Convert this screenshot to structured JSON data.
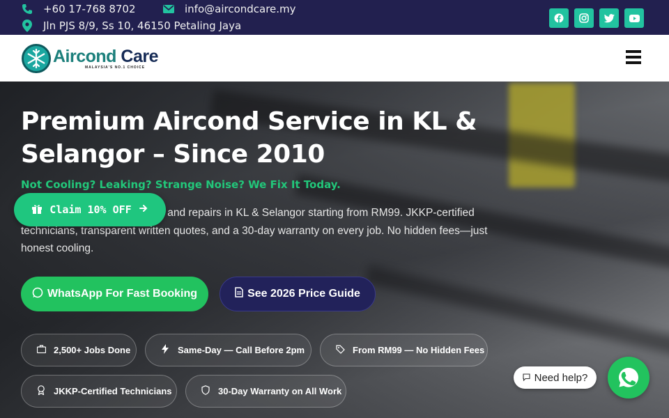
{
  "topbar": {
    "phone": "+60 17-768 8702",
    "email": "info@aircondcare.my",
    "address": "Jln PJS 8/9, Ss 10, 46150 Petaling Jaya",
    "socials": [
      "facebook-icon",
      "instagram-icon",
      "twitter-icon",
      "youtube-icon"
    ],
    "background": "#22204f",
    "accent": "#22c3a0"
  },
  "header": {
    "logo_text_1": "Aircond",
    "logo_text_2": " Care",
    "logo_tagline": "MALAYSIA'S NO.1 CHOICE"
  },
  "hero": {
    "title": "Premium Aircond Service in KL & Selangor – Since 2010",
    "subtitle": "Not Cooling? Leaking? Strange Noise? We Fix It Today.",
    "description": "Professional aircond servicing and repairs in KL & Selangor starting from RM99. JKKP-certified technicians, transparent written quotes, and a 30-day warranty on every job. No hidden fees—just honest cooling.",
    "claim_label": "Claim 10% OFF",
    "btn_whatsapp": "WhatsApp For Fast Booking",
    "btn_price": "See 2026 Price Guide",
    "badges": [
      {
        "icon": "briefcase-icon",
        "label": "2,500+ Jobs Done"
      },
      {
        "icon": "bolt-icon",
        "label": "Same-Day — Call Before 2pm"
      },
      {
        "icon": "tag-icon",
        "label": "From RM99 — No Hidden Fees"
      },
      {
        "icon": "certificate-icon",
        "label": "JKKP-Certified Technicians"
      },
      {
        "icon": "shield-icon",
        "label": "30-Day Warranty on All Work"
      }
    ]
  },
  "chat": {
    "help_label": "Need help?"
  },
  "colors": {
    "green": "#22c25f",
    "navy": "#22225a",
    "subtitle_green": "#22c77a"
  }
}
